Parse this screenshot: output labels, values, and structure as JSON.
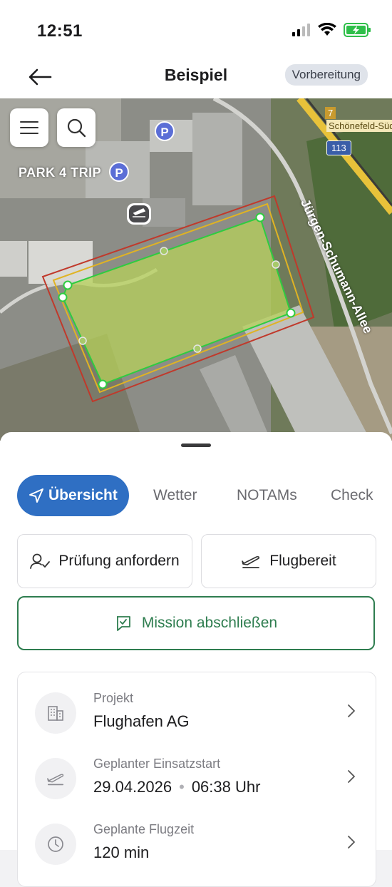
{
  "status_bar": {
    "time": "12:51"
  },
  "header": {
    "title": "Beispiel",
    "status_badge": "Vorbereitung"
  },
  "map": {
    "poi_label": "PARK 4 TRIP",
    "road_label": "Jürgen-Schumann-Allee",
    "exit_number": "7",
    "place_label": "Schönefeld-Süd",
    "route_shield": "113",
    "colors": {
      "outer_zone": "#c0392b",
      "middle_zone": "#e0b323",
      "inner_zone": "#2ecc40"
    }
  },
  "tabs": [
    {
      "label": "Übersicht",
      "active": true
    },
    {
      "label": "Wetter"
    },
    {
      "label": "NOTAMs"
    },
    {
      "label": "Check"
    }
  ],
  "actions": {
    "request_review": "Prüfung anfordern",
    "flight_ready": "Flugbereit",
    "finish_mission": "Mission abschließen"
  },
  "details": [
    {
      "label": "Projekt",
      "value": "Flughafen AG",
      "icon": "building-icon"
    },
    {
      "label": "Geplanter Einsatzstart",
      "date": "29.04.2026",
      "time": "06:38 Uhr",
      "icon": "takeoff-icon"
    },
    {
      "label": "Geplante Flugzeit",
      "value": "120 min",
      "icon": "clock-icon"
    }
  ],
  "accent_colors": {
    "primary": "#2f6fc3",
    "success": "#2e7d4f"
  }
}
